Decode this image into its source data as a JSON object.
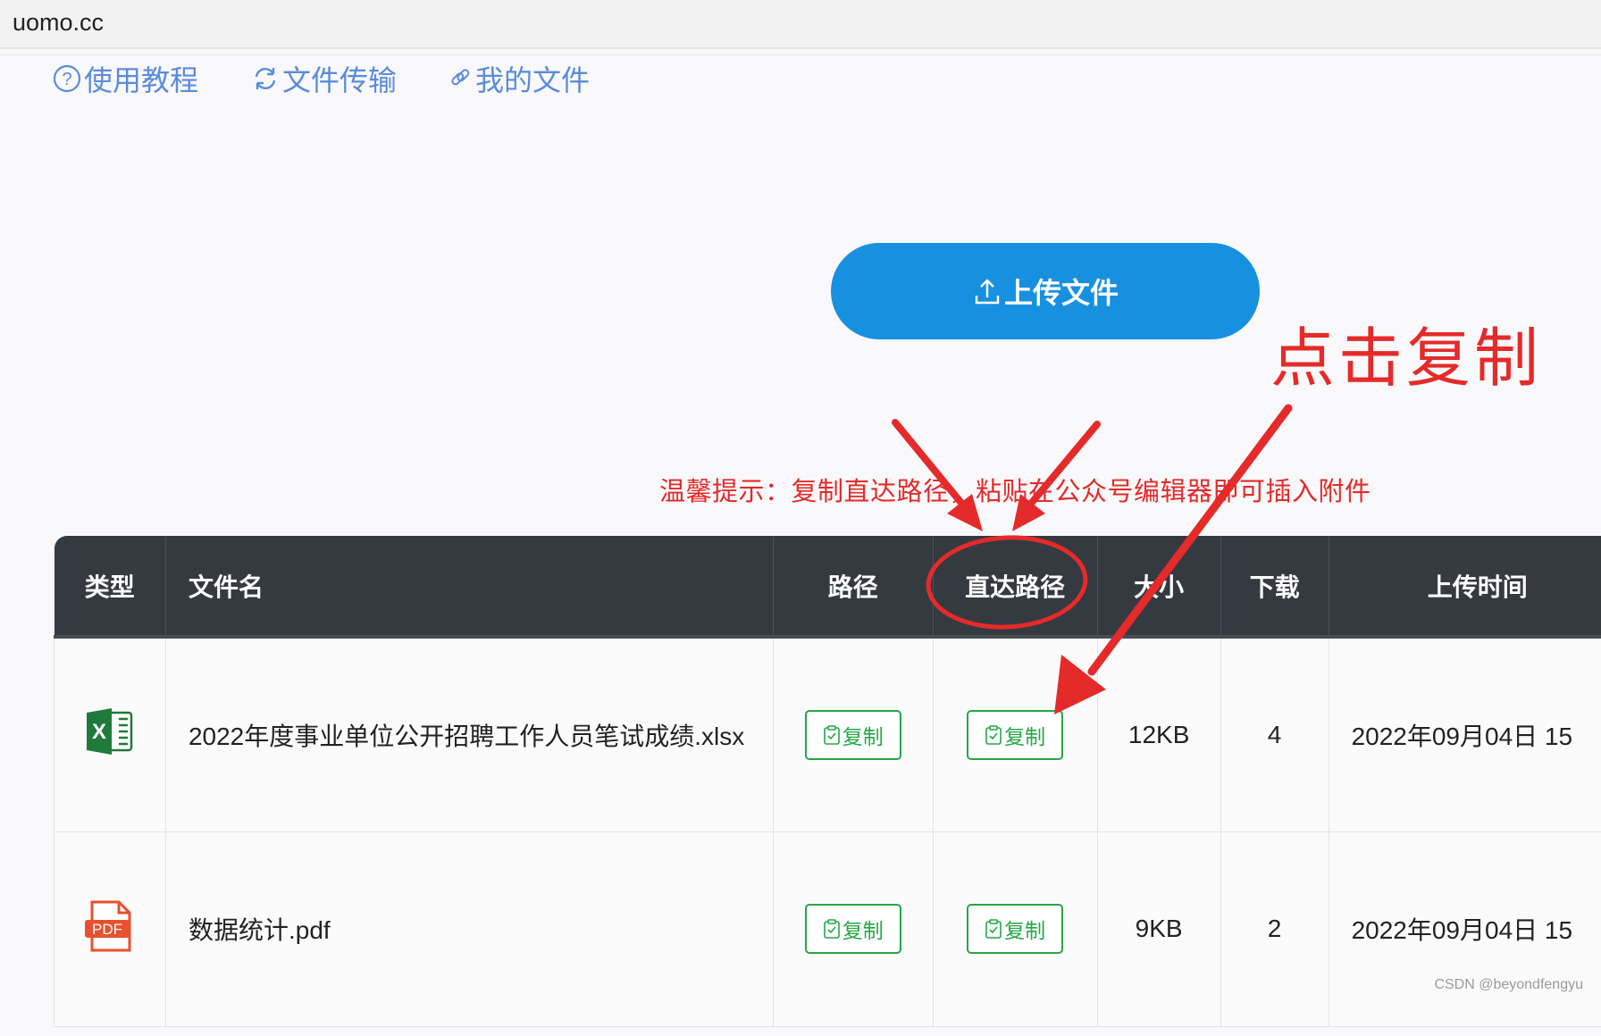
{
  "browser": {
    "url": "uomo.cc"
  },
  "nav": {
    "items": [
      {
        "label": "使用教程",
        "icon": "help-circle-icon"
      },
      {
        "label": "文件传输",
        "icon": "refresh-icon"
      },
      {
        "label": "我的文件",
        "icon": "link-icon"
      }
    ]
  },
  "upload": {
    "label": "上传文件",
    "icon": "upload-icon"
  },
  "hint": "温馨提示：复制直达路径，粘贴在公众号编辑器即可插入附件",
  "annotation": {
    "title": "点击复制"
  },
  "table": {
    "headers": [
      "类型",
      "文件名",
      "路径",
      "直达路径",
      "大小",
      "下载",
      "上传时间"
    ],
    "rows": [
      {
        "type_icon": "excel-file-icon",
        "name": "2022年度事业单位公开招聘工作人员笔试成绩.xlsx",
        "path_btn": "复制",
        "direct_btn": "复制",
        "size": "12KB",
        "downloads": "4",
        "time": "2022年09月04日 15"
      },
      {
        "type_icon": "pdf-file-icon",
        "type_label": "PDF",
        "name": "数据统计.pdf",
        "path_btn": "复制",
        "direct_btn": "复制",
        "size": "9KB",
        "downloads": "2",
        "time": "2022年09月04日 15"
      }
    ]
  },
  "watermark": "CSDN @beyondfengyu",
  "colors": {
    "accent": "#1890e0",
    "nav": "#5a8bdc",
    "annotation": "#e52a2a",
    "copy": "#25a746",
    "header_bg": "#353940"
  }
}
